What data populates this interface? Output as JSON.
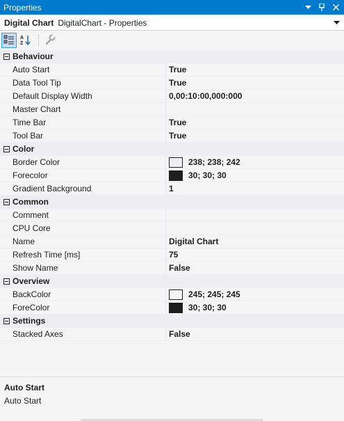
{
  "window": {
    "title": "Properties",
    "pin_icon": "pin-icon",
    "close_icon": "close-icon",
    "dropdown_icon": "chevron-down-icon",
    "accent": "#007acc"
  },
  "object": {
    "name": "Digital Chart",
    "type": "DigitalChart - Properties"
  },
  "toolbar": {
    "categorized_icon": "categorized-icon",
    "alphabetical_icon": "alphabetical-icon",
    "property_pages_icon": "wrench-icon"
  },
  "categories": [
    {
      "name": "Behaviour",
      "properties": [
        {
          "name": "Auto Start",
          "value": "True"
        },
        {
          "name": "Data Tool Tip",
          "value": "True"
        },
        {
          "name": "Default Display Width",
          "value": "0,00:10:00,000:000"
        },
        {
          "name": "Master Chart",
          "value": ""
        },
        {
          "name": "Time Bar",
          "value": "True"
        },
        {
          "name": "Tool Bar",
          "value": "True"
        }
      ]
    },
    {
      "name": "Color",
      "properties": [
        {
          "name": "Border Color",
          "value": "238; 238; 242",
          "color": "#eeeef2"
        },
        {
          "name": "Forecolor",
          "value": "30; 30; 30",
          "color": "#1e1e1e"
        },
        {
          "name": "Gradient Background",
          "value": "1"
        }
      ]
    },
    {
      "name": "Common",
      "properties": [
        {
          "name": "Comment",
          "value": ""
        },
        {
          "name": "CPU Core",
          "value": ""
        },
        {
          "name": "Name",
          "value": "Digital Chart"
        },
        {
          "name": "Refresh Time [ms]",
          "value": "75"
        },
        {
          "name": "Show Name",
          "value": "False"
        }
      ]
    },
    {
      "name": "Overview",
      "properties": [
        {
          "name": "BackColor",
          "value": "245; 245; 245",
          "color": "#f5f5f5"
        },
        {
          "name": "ForeColor",
          "value": "30; 30; 30",
          "color": "#1e1e1e"
        }
      ]
    },
    {
      "name": "Settings",
      "properties": [
        {
          "name": "Stacked Axes",
          "value": "False"
        }
      ]
    }
  ],
  "description": {
    "title": "Auto Start",
    "text": "Auto Start"
  }
}
